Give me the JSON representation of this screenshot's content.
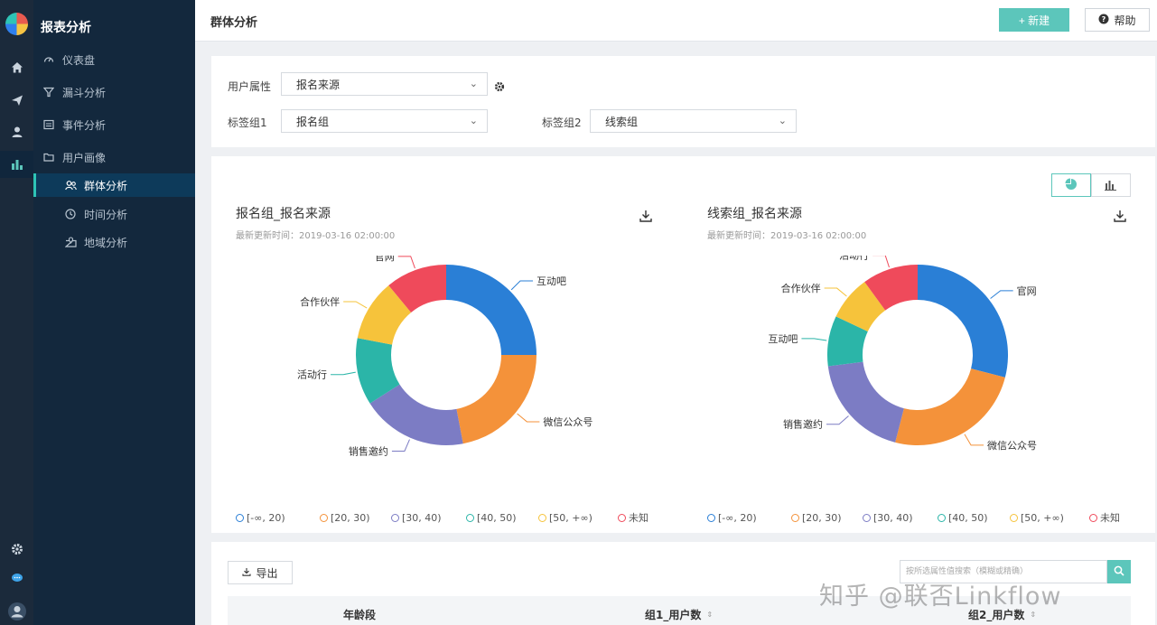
{
  "sidebar": {
    "section_title": "报表分析",
    "items": [
      {
        "label": "仪表盘",
        "icon": "dashboard-icon"
      },
      {
        "label": "漏斗分析",
        "icon": "funnel-icon"
      },
      {
        "label": "事件分析",
        "icon": "event-icon"
      },
      {
        "label": "用户画像",
        "icon": "folder-icon"
      },
      {
        "label": "群体分析",
        "icon": "group-icon"
      },
      {
        "label": "时间分析",
        "icon": "clock-icon"
      },
      {
        "label": "地域分析",
        "icon": "map-icon"
      }
    ],
    "active_index": 4
  },
  "header": {
    "title": "群体分析",
    "new_label": "+ 新建",
    "help_label": "帮助"
  },
  "filters": {
    "user_attr_label": "用户属性",
    "user_attr_value": "报名来源",
    "tag_group1_label": "标签组1",
    "tag_group1_value": "报名组",
    "tag_group2_label": "标签组2",
    "tag_group2_value": "线索组"
  },
  "colors": {
    "accent": "#5cc6bb",
    "sidebar_bg": "#13283d",
    "segments": {
      "官网": "#ef4a5b",
      "互动吧": "#2a7fd6",
      "微信公众号": "#f4923a",
      "销售邀约": "#7c7cc4",
      "活动行": "#f2c03a",
      "合作伙伴": "#f6c33b",
      "互动吧_teal": "#2bb5a8"
    }
  },
  "chart_data": [
    {
      "type": "pie",
      "title": "报名组_报名来源",
      "updated": "最新更新时间：2019-03-16 02:00:00",
      "slices": [
        {
          "label": "互动吧",
          "value": 25,
          "color": "#2a7fd6"
        },
        {
          "label": "微信公众号",
          "value": 22,
          "color": "#f4923a"
        },
        {
          "label": "销售邀约",
          "value": 19,
          "color": "#7c7cc4"
        },
        {
          "label": "活动行",
          "value": 12,
          "color": "#2bb5a8"
        },
        {
          "label": "合作伙伴",
          "value": 11,
          "color": "#f6c33b"
        },
        {
          "label": "官网",
          "value": 11,
          "color": "#ef4a5b"
        }
      ],
      "legend": [
        "[-∞, 20)",
        "[20, 30)",
        "[30, 40)",
        "[40, 50)",
        "[50, +∞)",
        "未知"
      ]
    },
    {
      "type": "pie",
      "title": "线索组_报名来源",
      "updated": "最新更新时间：2019-03-16 02:00:00",
      "slices": [
        {
          "label": "官网",
          "value": 29,
          "color": "#2a7fd6"
        },
        {
          "label": "微信公众号",
          "value": 25,
          "color": "#f4923a"
        },
        {
          "label": "销售邀约",
          "value": 19,
          "color": "#7c7cc4"
        },
        {
          "label": "互动吧",
          "value": 9,
          "color": "#2bb5a8"
        },
        {
          "label": "合作伙伴",
          "value": 8,
          "color": "#f6c33b"
        },
        {
          "label": "活动行",
          "value": 10,
          "color": "#ef4a5b"
        }
      ],
      "legend": [
        "[-∞, 20)",
        "[20, 30)",
        "[30, 40)",
        "[40, 50)",
        "[50, +∞)",
        "未知"
      ]
    }
  ],
  "legend_colors": [
    "#2a7fd6",
    "#f4923a",
    "#7c7cc4",
    "#2bb5a8",
    "#f6c33b",
    "#ef4a5b"
  ],
  "table": {
    "export_label": "导出",
    "search_placeholder": "按所选属性值搜索（模糊或精确）",
    "columns": [
      "年龄段",
      "组1_用户数",
      "组2_用户数"
    ]
  },
  "watermark": "知乎 @联否Linkflow"
}
